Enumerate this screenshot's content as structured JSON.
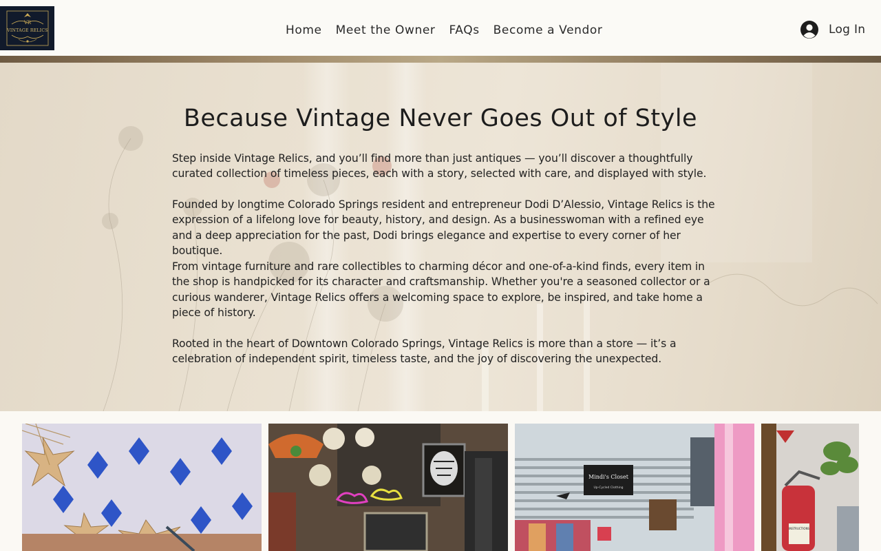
{
  "header": {
    "logo_text": "VINTAGE RELICS",
    "logo_monogram": "VR",
    "nav": [
      {
        "label": "Home"
      },
      {
        "label": "Meet the Owner"
      },
      {
        "label": "FAQs"
      },
      {
        "label": "Become a Vendor"
      }
    ],
    "login_label": "Log In",
    "login_icon": "user-avatar-icon"
  },
  "hero": {
    "title": "Because Vintage Never Goes Out of Style",
    "paragraphs": [
      "Step inside Vintage Relics, and you’ll find more than just antiques — you’ll discover a thoughtfully curated collection of timeless pieces, each with a story, selected with care, and displayed with style.",
      "Founded by longtime Colorado Springs resident and entrepreneur Dodi D’Alessio, Vintage Relics is the expression of a lifelong love for beauty, history, and design. As a businesswoman with a refined eye and a deep appreciation for the past, Dodi brings elegance and expertise to every corner of her boutique.",
      "From vintage furniture and rare collectibles to charming décor and one-of-a-kind finds, every item in the shop is handpicked for its character and craftsmanship. Whether you're a seasoned collector or a curious wanderer, Vintage Relics offers a welcoming space to explore, be inspired, and take home a piece of history.",
      "Rooted in the heart of Downtown Colorado Springs, Vintage Relics is more than a store — it’s a celebration of independent spirit, timeless taste, and the joy of discovering the unexpected."
    ]
  },
  "gallery": {
    "sign_text_1": "Mindi's Closet",
    "sign_text_2": "Up-Cycled Clothing",
    "extinguisher_label": "INSTRUCTIONS"
  },
  "colors": {
    "logo_bg": "#111a2b",
    "logo_gold": "#c9a955",
    "page_bg": "#fbf9f4",
    "text": "#222222"
  }
}
